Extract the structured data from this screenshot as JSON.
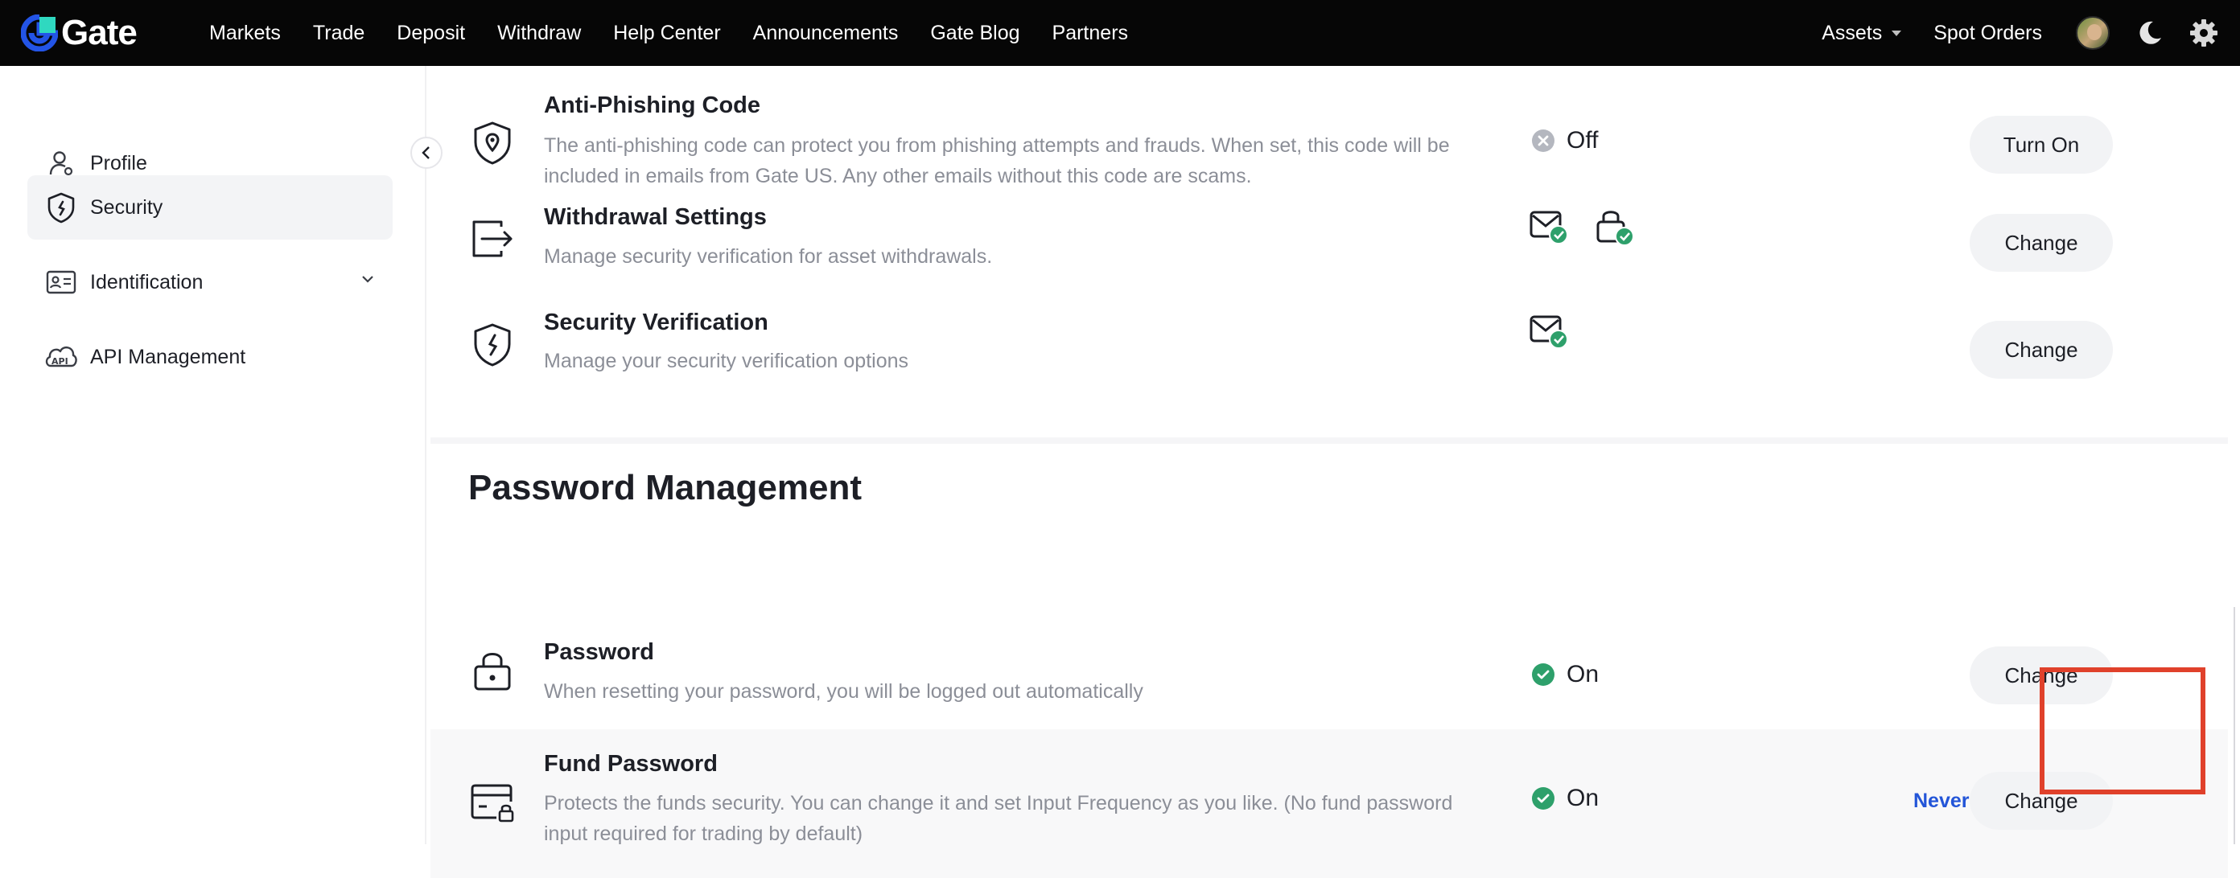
{
  "nav": {
    "logo_text": "Gate",
    "links": [
      "Markets",
      "Trade",
      "Deposit",
      "Withdraw",
      "Help Center",
      "Announcements",
      "Gate Blog",
      "Partners"
    ],
    "assets": "Assets",
    "spot_orders": "Spot Orders"
  },
  "sidebar": {
    "items": [
      {
        "label": "Profile",
        "icon": "user-icon"
      },
      {
        "label": "Security",
        "icon": "shield-icon"
      },
      {
        "label": "Identification",
        "icon": "id-card-icon"
      },
      {
        "label": "API Management",
        "icon": "api-icon"
      }
    ]
  },
  "security_rows": {
    "anti_phishing": {
      "title": "Anti-Phishing Code",
      "desc": "The anti-phishing code can protect you from phishing attempts and frauds. When set, this code will be included in emails from Gate US. Any other emails without this code are scams.",
      "status": "Off",
      "button": "Turn On"
    },
    "withdrawal": {
      "title": "Withdrawal Settings",
      "desc": "Manage security verification for asset withdrawals.",
      "button": "Change"
    },
    "verification": {
      "title": "Security Verification",
      "desc": "Manage your security verification options",
      "button": "Change"
    }
  },
  "password_section": {
    "title": "Password Management",
    "password": {
      "title": "Password",
      "desc": "When resetting your password, you will be logged out automatically",
      "status": "On",
      "button": "Change"
    },
    "fund_password": {
      "title": "Fund Password",
      "desc": "Protects the funds security. You can change it and set Input Frequency as you like. (No fund password input required for trading by default)",
      "status": "On",
      "frequency": "Never",
      "button": "Change"
    }
  },
  "colors": {
    "nav_bg": "#060606",
    "brand_blue": "#2355d8",
    "success_green": "#2ea06b",
    "highlight_red": "#e0412b"
  }
}
